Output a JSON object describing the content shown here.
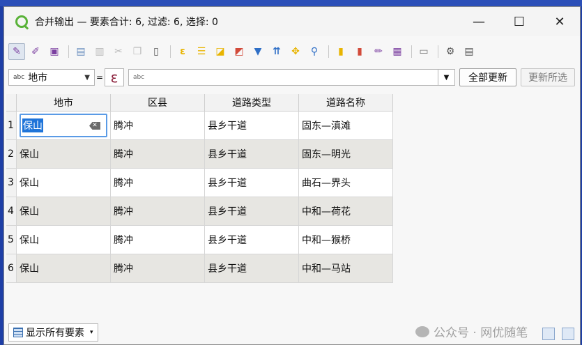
{
  "window": {
    "title": "合并输出 — 要素合计: 6, 过滤: 6, 选择: 0",
    "controls": [
      "—",
      "☐",
      "✕"
    ]
  },
  "toolbar": {
    "icons": [
      "toggle-editing-icon",
      "multi-edit-icon",
      "save-edits-icon",
      "add-feature-icon",
      "delete-feature-icon",
      "cut-icon",
      "copy-icon",
      "paste-icon",
      "expression-select-icon",
      "select-all-icon",
      "invert-selection-icon",
      "deselect-icon",
      "filter-icon",
      "move-selection-top-icon",
      "pan-to-selection-icon",
      "zoom-to-selection-icon",
      "new-field-icon",
      "delete-field-icon",
      "field-calculator-icon",
      "conditional-format-icon",
      "dock-icon",
      "actions-icon",
      "table-view-icon"
    ],
    "colors": {
      "accent_purple": "#7b3fa0",
      "accent_yellow": "#e8b400",
      "accent_red": "#d24a3a",
      "accent_blue": "#2f6fc6"
    }
  },
  "filter": {
    "field_type": "abc",
    "field_name": "地市",
    "operator": "=",
    "expression_symbol": "ε",
    "value_placeholder": "abc",
    "update_all": "全部更新",
    "update_selected": "更新所选"
  },
  "table": {
    "headers": [
      "地市",
      "区县",
      "道路类型",
      "道路名称"
    ],
    "rows": [
      {
        "num": "1",
        "city": "保山",
        "county": "腾冲",
        "type": "县乡干道",
        "name": "固东—滇滩"
      },
      {
        "num": "2",
        "city": "保山",
        "county": "腾冲",
        "type": "县乡干道",
        "name": "固东—明光"
      },
      {
        "num": "3",
        "city": "保山",
        "county": "腾冲",
        "type": "县乡干道",
        "name": "曲石—界头"
      },
      {
        "num": "4",
        "city": "保山",
        "county": "腾冲",
        "type": "县乡干道",
        "name": "中和—荷花"
      },
      {
        "num": "5",
        "city": "保山",
        "county": "腾冲",
        "type": "县乡干道",
        "name": "中和—猴桥"
      },
      {
        "num": "6",
        "city": "保山",
        "county": "腾冲",
        "type": "县乡干道",
        "name": "中和—马站"
      }
    ]
  },
  "status": {
    "show_all": "显示所有要素",
    "watermark": "公众号 · 网优随笔"
  }
}
